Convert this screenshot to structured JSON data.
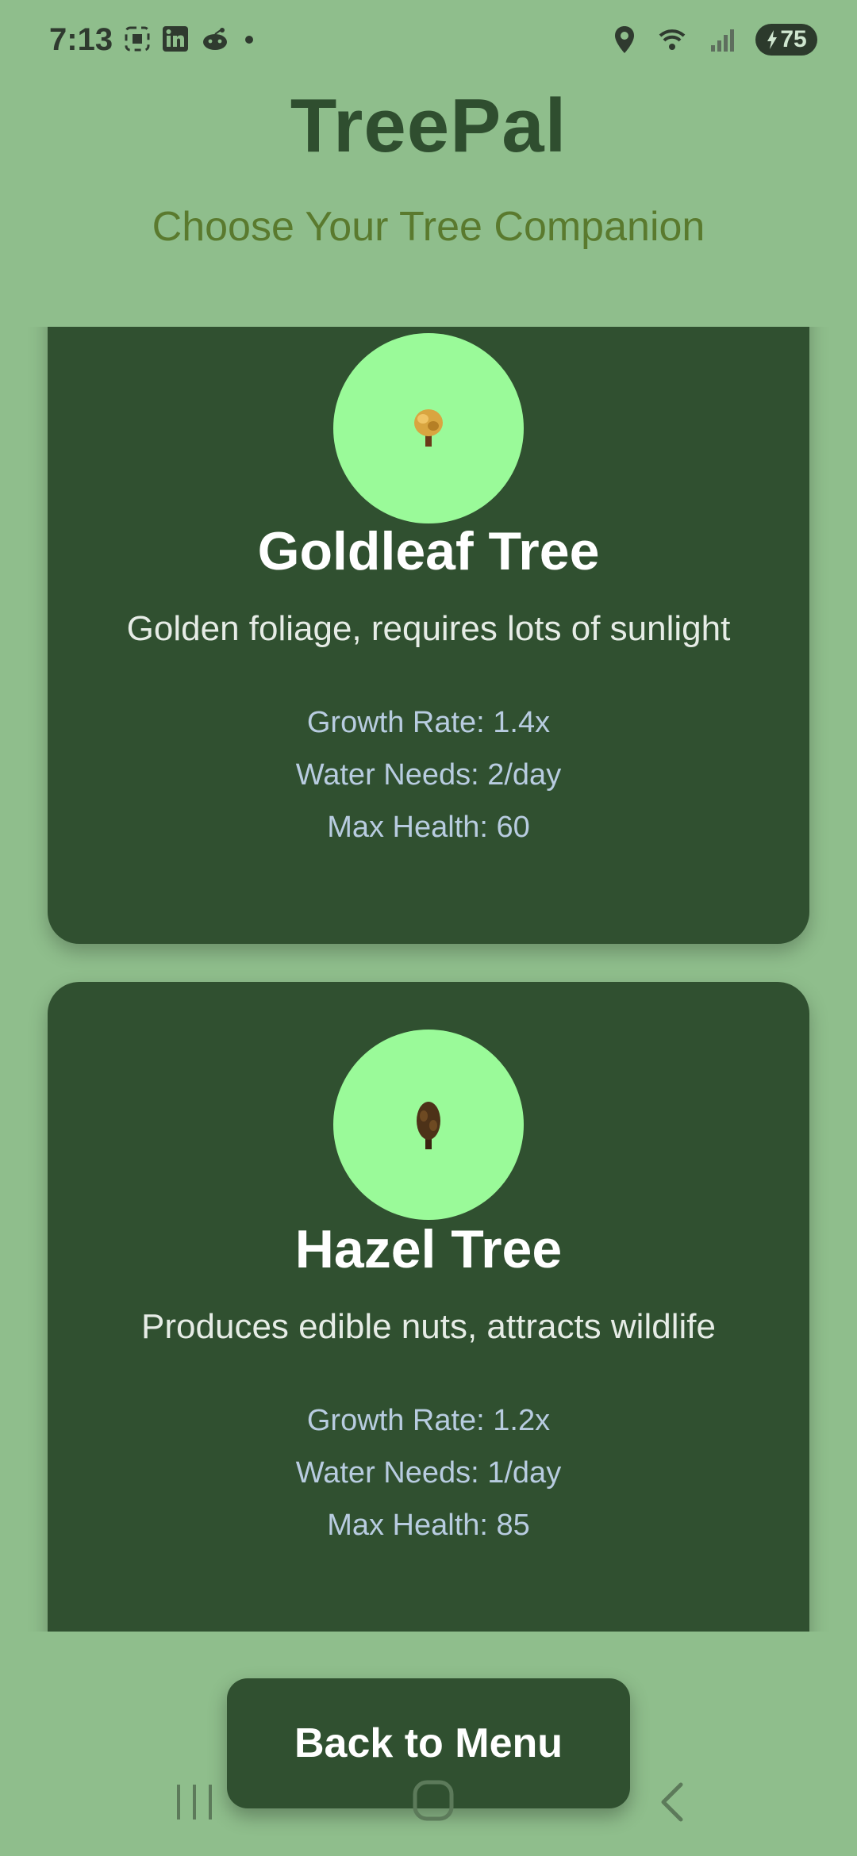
{
  "status": {
    "time": "7:13",
    "battery": "75"
  },
  "header": {
    "title": "TreePal",
    "subtitle": "Choose Your Tree Companion"
  },
  "trees": [
    {
      "name": "Goldleaf Tree",
      "description": "Golden foliage, requires lots of sunlight",
      "growth": "Growth Rate: 1.4x",
      "water": "Water Needs: 2/day",
      "health": "Max Health: 60",
      "icon": "goldleaf-tree-icon"
    },
    {
      "name": "Hazel Tree",
      "description": "Produces edible nuts, attracts wildlife",
      "growth": "Growth Rate: 1.2x",
      "water": "Water Needs: 1/day",
      "health": "Max Health: 85",
      "icon": "hazel-tree-icon"
    }
  ],
  "footer": {
    "back_label": "Back to Menu"
  },
  "colors": {
    "background": "#8fbe8c",
    "card": "#305030",
    "avatar": "#9afa99",
    "title": "#2f4e2f",
    "subtitle": "#5a7a2e",
    "stats": "#b8cce0"
  }
}
